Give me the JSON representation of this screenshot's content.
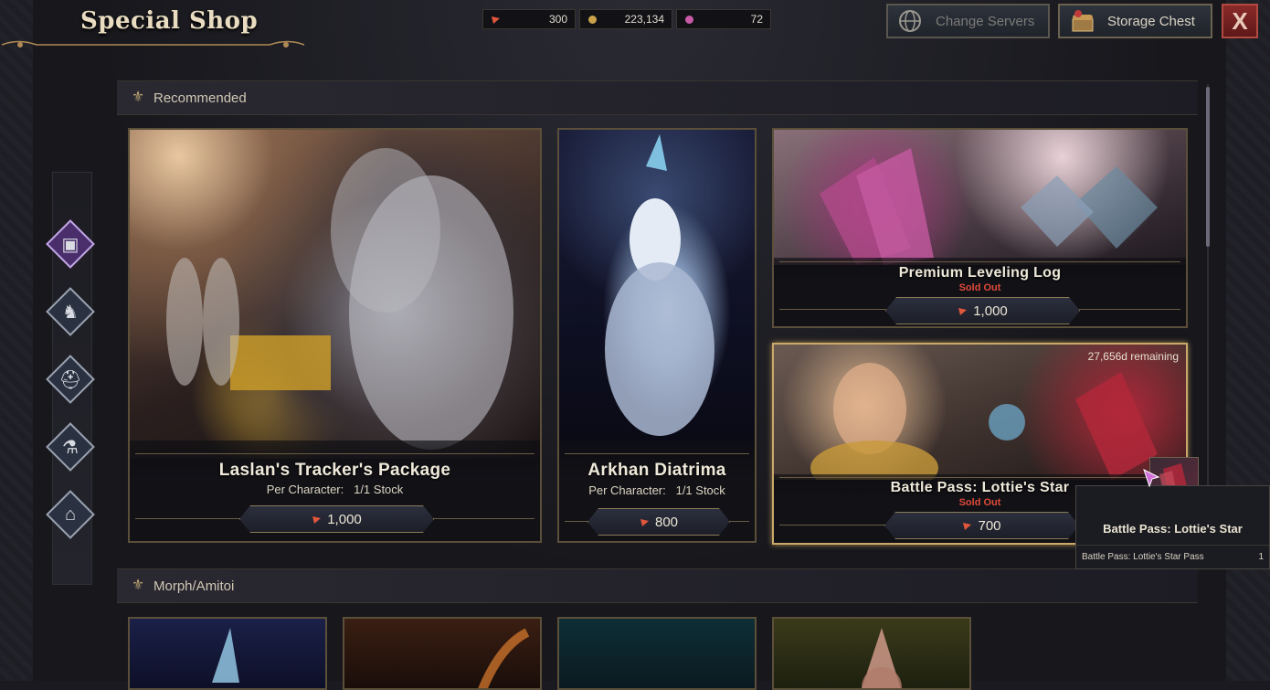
{
  "header": {
    "title": "Special Shop",
    "currencies": [
      {
        "icon": "crystal-currency-icon",
        "value": "300",
        "color": "#e0573c"
      },
      {
        "icon": "gold-coin-icon",
        "value": "223,134",
        "color": "#c9a24a"
      },
      {
        "icon": "pheon-gem-icon",
        "value": "72",
        "color": "#c85aa8"
      }
    ],
    "change_servers_label": "Change Servers",
    "storage_chest_label": "Storage Chest",
    "close_label": "X"
  },
  "sections": [
    {
      "label": "Recommended"
    },
    {
      "label": "Morph/Amitoi"
    }
  ],
  "categories": [
    {
      "icon": "package-icon",
      "active": true
    },
    {
      "icon": "mount-icon",
      "active": false
    },
    {
      "icon": "hat-icon",
      "active": false
    },
    {
      "icon": "potion-icon",
      "active": false
    },
    {
      "icon": "house-icon",
      "active": false
    }
  ],
  "products": {
    "laslan": {
      "name": "Laslan's Tracker's Package",
      "sub_prefix": "Per Character:",
      "stock": "1/1 Stock",
      "price": "1,000"
    },
    "arkhan": {
      "name": "Arkhan Diatrima",
      "sub_prefix": "Per Character:",
      "stock": "1/1 Stock",
      "price": "800"
    },
    "leveling": {
      "name": "Premium Leveling Log",
      "status": "Sold Out",
      "price": "1,000"
    },
    "battlepass": {
      "name": "Battle Pass: Lottie's Star",
      "status": "Sold Out",
      "price": "700",
      "remaining": "27,656d remaining"
    }
  },
  "tooltip": {
    "title": "Battle Pass: Lottie's Star",
    "item_name": "Battle Pass: Lottie's Star Pass",
    "item_qty": "1"
  },
  "colors": {
    "accent_gold": "#c9a86a",
    "sold_out": "#e04a3a",
    "tab_active": "#4a2e6c"
  }
}
